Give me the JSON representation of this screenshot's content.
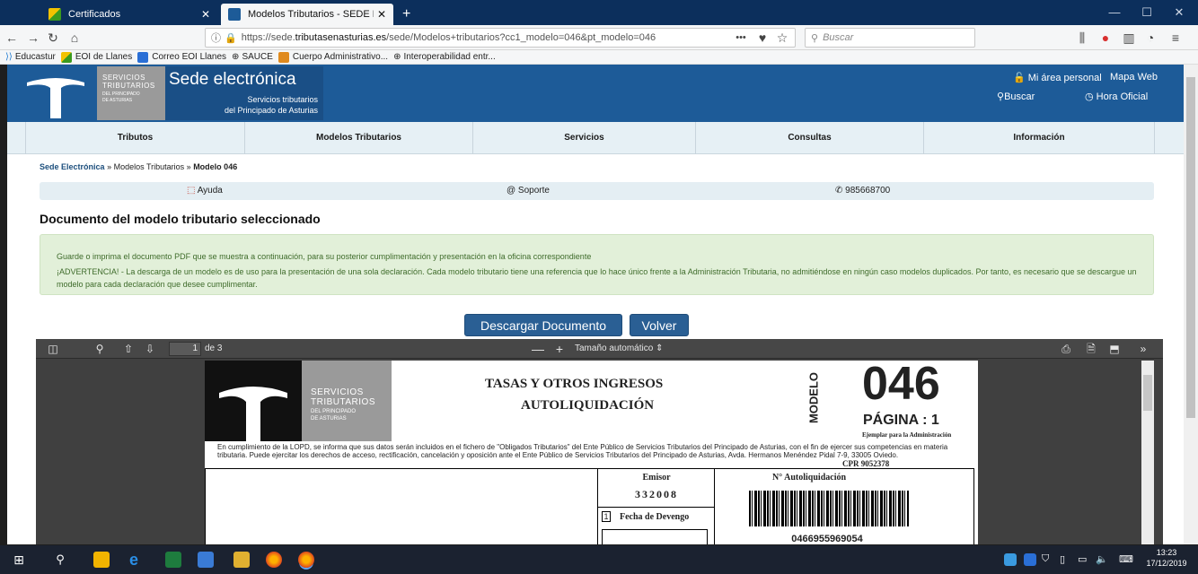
{
  "browser": {
    "tabs": [
      {
        "title": "Certificados",
        "active": false
      },
      {
        "title": "Modelos Tributarios - SEDE ELE",
        "active": true
      }
    ],
    "new_tab": "+",
    "url": "https://sede.tributasenasturias.es/sede/Modelos+tributarios?cc1_modelo=046&pt_modelo=046",
    "url_domain": "tributasenasturias.es",
    "url_prefix": "https://sede.",
    "url_suffix": "/sede/Modelos+tributarios?cc1_modelo=046&pt_modelo=046",
    "search_placeholder": "Buscar",
    "page_actions": "•••",
    "bookmarks": [
      "Educastur",
      "EOI de Llanes",
      "Correo EOI Llanes",
      "SAUCE",
      "Cuerpo Administrativo...",
      "Interoperabilidad entr..."
    ]
  },
  "site": {
    "logo_line1": "SERVICIOS",
    "logo_line2": "TRIBUTARIOS",
    "logo_line3": "DEL PRINCIPADO",
    "logo_line4": "DE ASTURIAS",
    "title": "Sede electrónica",
    "subtitle1": "Servicios tributarios",
    "subtitle2": "del Principado de Asturias",
    "area_personal": "Mi área personal",
    "mapa_web": "Mapa Web",
    "buscar": "Buscar",
    "hora_oficial": "Hora Oficial"
  },
  "menu": [
    "Tributos",
    "Modelos Tributarios",
    "Servicios",
    "Consultas",
    "Información"
  ],
  "breadcrumb": {
    "home": "Sede Electrónica",
    "sep": "»",
    "mid": "Modelos Tributarios",
    "current": "Modelo 046"
  },
  "infobar": {
    "ayuda": "Ayuda",
    "soporte": "@ Soporte",
    "telefono": "985668700"
  },
  "main": {
    "title": "Documento del modelo tributario seleccionado",
    "alert_line1": "Guarde o imprima el documento PDF que se muestra a continuación, para su posterior cumplimentación y presentación en la oficina correspondiente",
    "alert_line2": "¡ADVERTENCIA! - La descarga de un modelo es de uso para la presentación de una sola declaración. Cada modelo tributario tiene una referencia que lo hace único frente a la Administración Tributaria, no admitiéndose en ningún caso modelos duplicados. Por tanto, es necesario que se descargue un modelo para cada declaración que desee cumplimentar.",
    "btn_descargar": "Descargar Documento",
    "btn_volver": "Volver"
  },
  "pdf": {
    "page_current": "1",
    "page_of": "de 3",
    "zoom": "Tamaño automático",
    "heading1": "TASAS Y OTROS INGRESOS",
    "heading2": "AUTOLIQUIDACIÓN",
    "modelo_label": "MODELO",
    "modelo_num": "046",
    "pagina": "PÁGINA : 1",
    "ejemplar": "Ejemplar para la Administración",
    "lopd": "En cumplimiento de la LOPD, se informa que sus datos serán incluidos en el fichero de \"Obligados Tributarios\" del Ente Público de Servicios Tributarios del Principado de Asturias, con el fin de ejercer sus competencias en  materia tributaria. Puede ejercitar los derechos de acceso, rectificación, cancelación y oposición ante el Ente Público de Servicios Tributarios del Principado  de Asturias, Avda. Hermanos Menéndez Pidal 7-9, 33005 Oviedo.",
    "cpr": "CPR 9052378",
    "emisor_label": "Emisor",
    "emisor_value": "332008",
    "fecha_num": "1",
    "fecha_label": "Fecha de Devengo",
    "nautoliq_label": "N° Autoliquidación",
    "nautoliq_value": "0466955969054"
  },
  "taskbar": {
    "time": "13:23",
    "date": "17/12/2019"
  },
  "colors": {
    "header_blue": "#1d5b98",
    "alert_green_bg": "#e2f0d9",
    "button_blue": "#2a5f94"
  }
}
